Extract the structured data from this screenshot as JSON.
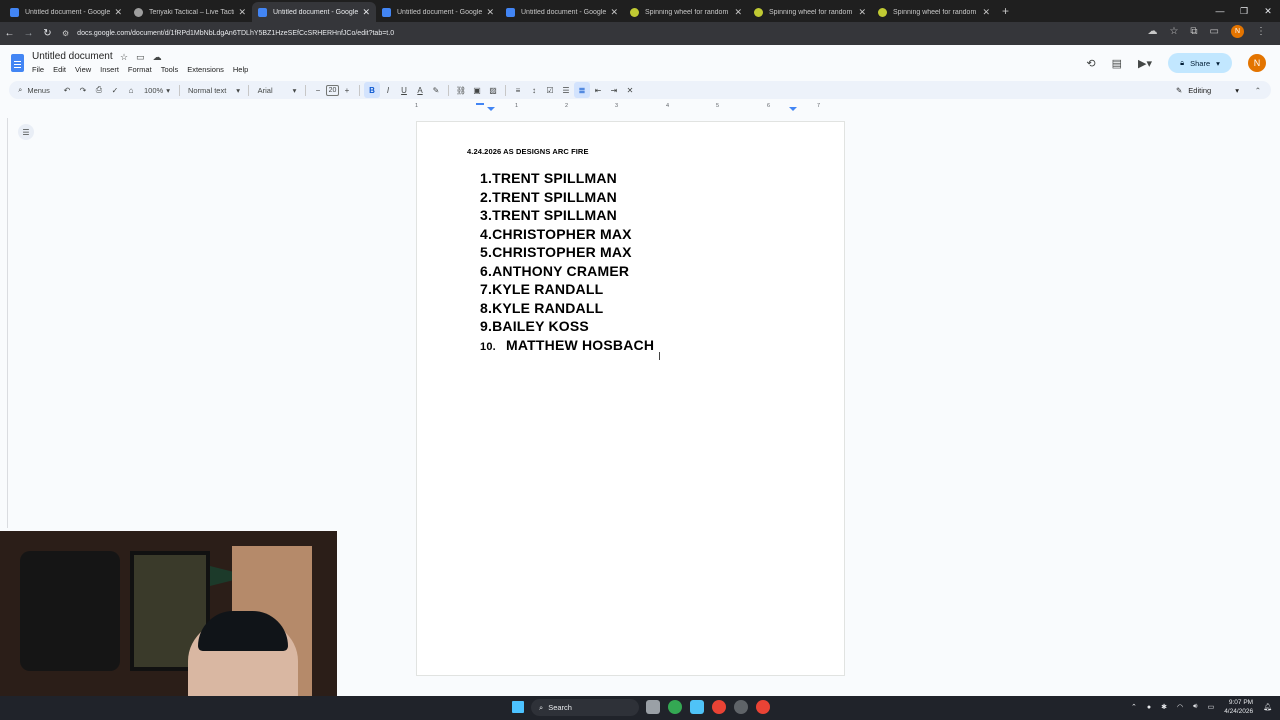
{
  "tabs": [
    {
      "title": "Untitled document - Google Docs",
      "icon": "docs-icon",
      "active": false
    },
    {
      "title": "Teriyaki Tactical – Live Tactical Wel...",
      "icon": "site-icon",
      "active": false
    },
    {
      "title": "Untitled document - Google Docs",
      "icon": "docs-icon",
      "active": true
    },
    {
      "title": "Untitled document - Google Docs",
      "icon": "docs-icon",
      "active": false
    },
    {
      "title": "Untitled document - Google Docs",
      "icon": "docs-icon",
      "active": false
    },
    {
      "title": "Spinning wheel for random choic...",
      "icon": "wheel-icon",
      "active": false
    },
    {
      "title": "Spinning wheel for random choic...",
      "icon": "wheel-icon",
      "active": false
    },
    {
      "title": "Spinning wheel for random choic...",
      "icon": "wheel-icon",
      "active": false
    }
  ],
  "address": {
    "url": "docs.google.com/document/d/1fRPd1MbNbLdgAn6TDLhY5BZ1HzeSEfCcSRHERHnfJCo/edit?tab=t.0"
  },
  "profile_initial": "N",
  "doc": {
    "title": "Untitled document",
    "menu": [
      "File",
      "Edit",
      "View",
      "Insert",
      "Format",
      "Tools",
      "Extensions",
      "Help"
    ],
    "share_label": "Share",
    "avatar_initial": "N"
  },
  "toolbar": {
    "menus_label": "Menus",
    "zoom": "100%",
    "style": "Normal text",
    "font": "Arial",
    "font_size": "20",
    "mode": "Editing"
  },
  "ruler_labels": [
    "1",
    "1",
    "2",
    "3",
    "4",
    "5",
    "6",
    "7"
  ],
  "content": {
    "heading": "4.24.2026 AS DESIGNS ARC FIRE",
    "entries": [
      {
        "num": "1.",
        "name": "TRENT SPILLMAN"
      },
      {
        "num": "2.",
        "name": "TRENT SPILLMAN"
      },
      {
        "num": "3.",
        "name": "TRENT SPILLMAN"
      },
      {
        "num": "4.",
        "name": "CHRISTOPHER MAX"
      },
      {
        "num": "5.",
        "name": "CHRISTOPHER MAX"
      },
      {
        "num": "6.",
        "name": "ANTHONY CRAMER"
      },
      {
        "num": "7.",
        "name": "KYLE RANDALL"
      },
      {
        "num": "8.",
        "name": "KYLE RANDALL"
      },
      {
        "num": "9.",
        "name": "BAILEY KOSS"
      },
      {
        "num": "10.",
        "name": "MATTHEW HOSBACH"
      }
    ]
  },
  "taskbar": {
    "search_label": "Search",
    "time": "9:07 PM",
    "date": "4/24/2026"
  },
  "colors": {
    "share_bg": "#c2e7ff",
    "accent": "#0b57d0",
    "toolbar_bg": "#edf2fa"
  }
}
